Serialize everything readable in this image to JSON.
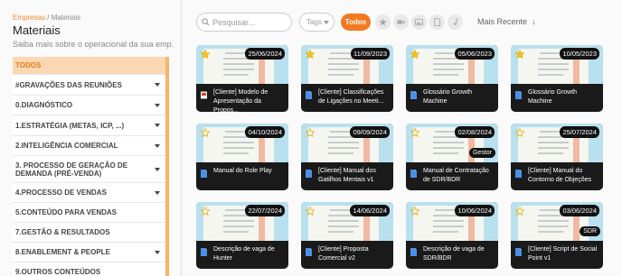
{
  "breadcrumb": {
    "link": "Empresas",
    "separator": " / ",
    "current": "Materiais"
  },
  "header": {
    "title": "Materiais",
    "subtitle": "Saiba mais sobre o operacional da sua emp."
  },
  "categories": [
    {
      "label": "TODOS",
      "active": true,
      "has_caret": false
    },
    {
      "label": "#GRAVAÇÕES DAS REUNIÕES",
      "has_caret": true
    },
    {
      "label": "0.DIAGNÓSTICO",
      "has_caret": true
    },
    {
      "label": "1.ESTRATÉGIA (METAS, ICP, ...)",
      "has_caret": true
    },
    {
      "label": "2.INTELIGÊNCIA COMERCIAL",
      "has_caret": true
    },
    {
      "label": "3. PROCESSO DE GERAÇÃO DE DEMANDA (PRÉ-VENDA)",
      "has_caret": true
    },
    {
      "label": "4.PROCESSO DE VENDAS",
      "has_caret": true
    },
    {
      "label": "5.CONTEÚDO PARA VENDAS",
      "has_caret": false
    },
    {
      "label": "7.GESTÃO & RESULTADOS",
      "has_caret": false
    },
    {
      "label": "8.ENABLEMENT & PEOPLE",
      "has_caret": true
    },
    {
      "label": "9.OUTROS CONTEÚDOS",
      "has_caret": false
    }
  ],
  "toolbar": {
    "search_placeholder": "Pesquisar...",
    "tags_label": "Tags",
    "todos_label": "Todos",
    "filter_icons": [
      "star-icon",
      "video-icon",
      "image-icon",
      "document-icon",
      "audio-icon"
    ],
    "sort_label": "Mais Recente",
    "sort_arrow": "↓"
  },
  "cards": [
    {
      "title": "[Cliente] Modelo de Apresentação da Propos...",
      "date": "25/06/2024",
      "starred": true,
      "file_icon": "presentation-icon"
    },
    {
      "title": "[Cliente] Classificações de Ligações no Meeti...",
      "date": "11/09/2023",
      "starred": true,
      "file_icon": "document-icon"
    },
    {
      "title": "Glossário Growth Machine",
      "date": "05/06/2023",
      "starred": true,
      "file_icon": "document-icon"
    },
    {
      "title": "Glossário Growth Machine",
      "date": "10/05/2023",
      "starred": true,
      "file_icon": "document-icon"
    },
    {
      "title": "Manual do Role Play",
      "date": "04/10/2024",
      "starred": false,
      "file_icon": "document-icon"
    },
    {
      "title": "[Cliente] Manual dos Gatilhos Mentais v1",
      "date": "09/09/2024",
      "starred": false,
      "file_icon": "document-icon"
    },
    {
      "title": "Manual de Contratação de SDR/BDR",
      "date": "02/08/2024",
      "starred": false,
      "file_icon": "document-icon",
      "tag": "Gestor"
    },
    {
      "title": "[Cliente] Manual do Contorno de Objeções",
      "date": "25/07/2024",
      "starred": false,
      "file_icon": "document-icon"
    },
    {
      "title": "Descrição de vaga de Hunter",
      "date": "22/07/2024",
      "starred": false,
      "file_icon": "document-icon"
    },
    {
      "title": "[Cliente] Proposta Comercial v2",
      "date": "14/06/2024",
      "starred": false,
      "file_icon": "document-icon"
    },
    {
      "title": "Descrição de vaga de SDR/BDR",
      "date": "10/06/2024",
      "starred": false,
      "file_icon": "document-icon"
    },
    {
      "title": "[Cliente] Script de Social Point v1",
      "date": "03/06/2024",
      "starred": false,
      "file_icon": "document-icon",
      "tag": "SDR"
    }
  ],
  "colors": {
    "accent": "#f37920",
    "active_bg": "#fbd8b3",
    "active_text": "#e07a15",
    "thumb_bg": "#b9e0ef",
    "card_bg": "#1a1a1a",
    "star_filled": "#f5c518"
  }
}
